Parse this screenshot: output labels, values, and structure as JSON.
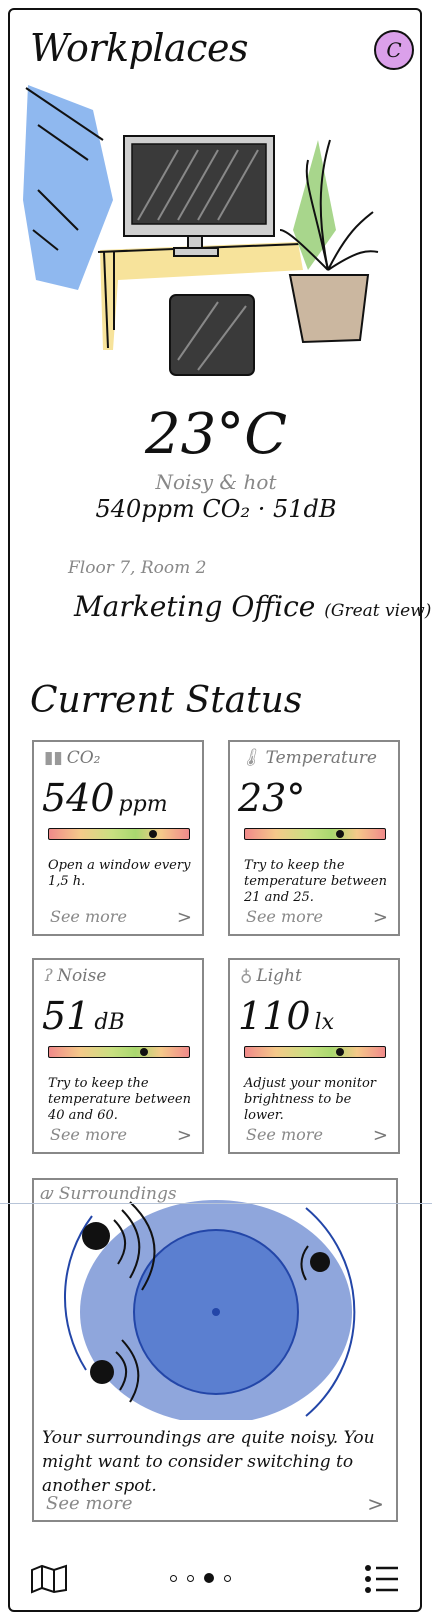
{
  "header": {
    "title": "Workplaces",
    "avatar_initial": "C"
  },
  "hero": {
    "temperature": "23°C",
    "condition": "Noisy & hot",
    "measurements": "540ppm CO₂ · 51dB"
  },
  "location": {
    "floor_room": "Floor 7, Room 2",
    "office_name": "Marketing Office",
    "office_note": "(Great view)"
  },
  "status": {
    "title": "Current Status",
    "cards": [
      {
        "label": "CO₂",
        "value": "540",
        "unit": "ppm",
        "level": 0.74,
        "tip": "Open a window every 1,5 h.",
        "more": "See more",
        "chevron": ">"
      },
      {
        "label": "Temperature",
        "value": "23°",
        "unit": "",
        "level": 0.68,
        "tip": "Try to keep the temperature between 21 and 25.",
        "more": "See more",
        "chevron": ">"
      },
      {
        "label": "Noise",
        "value": "51",
        "unit": "dB",
        "level": 0.68,
        "tip": "Try to keep the temperature between 40 and 60.",
        "more": "See more",
        "chevron": ">"
      },
      {
        "label": "Light",
        "value": "110",
        "unit": "lx",
        "level": 0.68,
        "tip": "Adjust your monitor brightness to be lower.",
        "more": "See more",
        "chevron": ">"
      }
    ]
  },
  "surroundings": {
    "label": "Surroundings",
    "description": "Your surroundings are quite noisy. You might want to consider switching to another spot.",
    "more": "See more",
    "chevron": ">"
  },
  "bottom_nav": {
    "page_count": 4,
    "active_page": 3,
    "map_icon": "map-icon",
    "list_icon": "list-icon"
  },
  "colors": {
    "avatar": "#dba0ea",
    "window_blue": "#8fb8ef",
    "desk_yellow": "#f7e39b",
    "plant_green": "#a8d68c",
    "pot": "#cbb7a0",
    "surround_blue": "#8fa6dc",
    "surround_inner": "#5b7fd0"
  }
}
